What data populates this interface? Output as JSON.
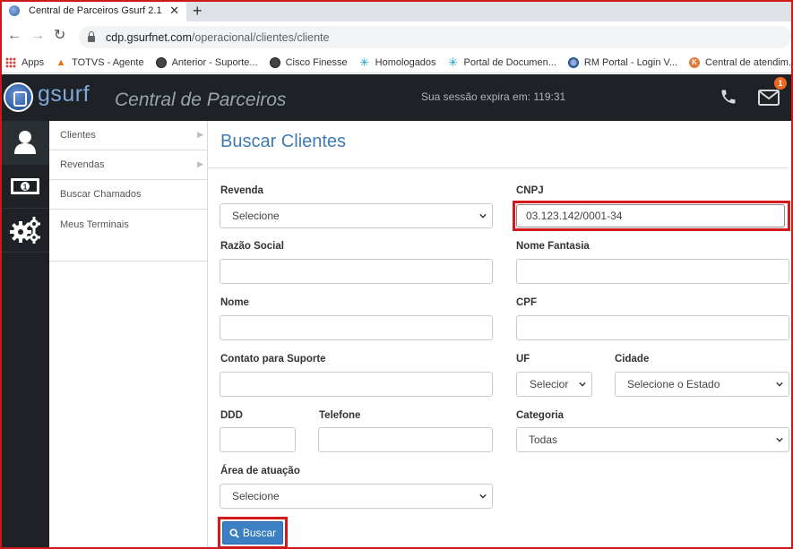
{
  "browser": {
    "tab_title": "Central de Parceiros Gsurf 2.1",
    "tab_close": "✕",
    "new_tab": "+",
    "url_domain": "cdp.gsurfnet.com",
    "url_path": "/operacional/clientes/cliente",
    "bookmarks": [
      {
        "label": "Apps",
        "icon": "apps-grid-icon"
      },
      {
        "label": "TOTVS - Agente",
        "icon": "totvs-icon"
      },
      {
        "label": "Anterior - Suporte...",
        "icon": "globe-icon"
      },
      {
        "label": "Cisco Finesse",
        "icon": "globe-icon"
      },
      {
        "label": "Homologados",
        "icon": "star-burst-icon"
      },
      {
        "label": "Portal de Documen...",
        "icon": "star-burst-icon"
      },
      {
        "label": "RM Portal - Login V...",
        "icon": "rm-portal-icon"
      },
      {
        "label": "Central de atendim...",
        "icon": "k-icon"
      }
    ]
  },
  "header": {
    "logo_text": "gsurf",
    "app_title": "Central de Parceiros",
    "session_text": "Sua sessão expira em: 119:31",
    "notification_count": "1"
  },
  "sidebar": {
    "icons": [
      "user-icon",
      "money-icon",
      "gears-icon"
    ],
    "items": [
      {
        "label": "Clientes",
        "has_submenu": true
      },
      {
        "label": "Revendas",
        "has_submenu": true
      },
      {
        "label": "Buscar Chamados",
        "has_submenu": false
      },
      {
        "label": "Meus Terminais",
        "has_submenu": false
      }
    ]
  },
  "form": {
    "title": "Buscar Clientes",
    "revenda": {
      "label": "Revenda",
      "value": "Selecione"
    },
    "cnpj": {
      "label": "CNPJ",
      "value": "03.123.142/0001-34"
    },
    "razao_social": {
      "label": "Razão Social",
      "value": ""
    },
    "nome_fantasia": {
      "label": "Nome Fantasia",
      "value": ""
    },
    "nome": {
      "label": "Nome",
      "value": ""
    },
    "cpf": {
      "label": "CPF",
      "value": ""
    },
    "contato": {
      "label": "Contato para Suporte",
      "value": ""
    },
    "uf": {
      "label": "UF",
      "value": "Selecior"
    },
    "cidade": {
      "label": "Cidade",
      "value": "Selecione o Estado"
    },
    "ddd": {
      "label": "DDD",
      "value": ""
    },
    "telefone": {
      "label": "Telefone",
      "value": ""
    },
    "categoria": {
      "label": "Categoria",
      "value": "Todas"
    },
    "area_atuacao": {
      "label": "Área de atuação",
      "value": "Selecione"
    },
    "search_button": "Buscar"
  },
  "colors": {
    "accent": "#3f7ab3",
    "button": "#3a80c2",
    "highlight": "#d3191c",
    "header_bg": "#1e2226"
  }
}
